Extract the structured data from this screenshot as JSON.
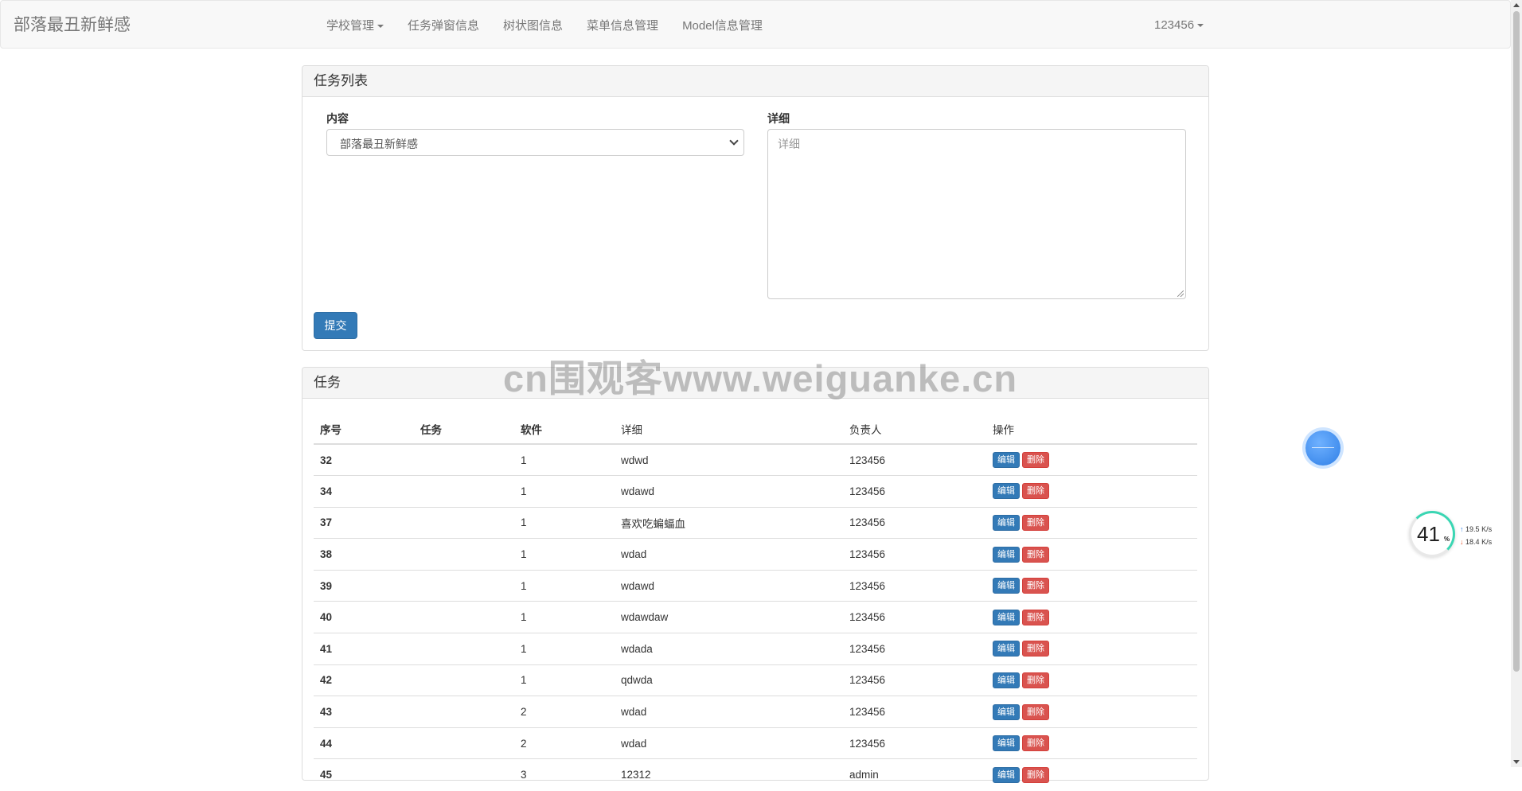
{
  "navbar": {
    "brand": "部落最丑新鲜感",
    "links": [
      "学校管理",
      "任务弹窗信息",
      "树状图信息",
      "菜单信息管理",
      "Model信息管理"
    ],
    "user": "123456"
  },
  "form_panel": {
    "title": "任务列表",
    "content_label": "内容",
    "content_selected": "部落最丑新鲜感",
    "detail_label": "详细",
    "detail_placeholder": "详细",
    "submit_label": "提交"
  },
  "table_panel": {
    "title": "任务",
    "headers": [
      "序号",
      "任务",
      "软件",
      "详细",
      "负责人",
      "操作"
    ],
    "edit_label": "编辑",
    "delete_label": "删除",
    "rows": [
      {
        "id": "32",
        "task": "",
        "software": "1",
        "detail": "wdwd",
        "owner": "123456"
      },
      {
        "id": "34",
        "task": "",
        "software": "1",
        "detail": "wdawd",
        "owner": "123456"
      },
      {
        "id": "37",
        "task": "",
        "software": "1",
        "detail": "喜欢吃蝙蝠血",
        "owner": "123456"
      },
      {
        "id": "38",
        "task": "",
        "software": "1",
        "detail": "wdad",
        "owner": "123456"
      },
      {
        "id": "39",
        "task": "",
        "software": "1",
        "detail": "wdawd",
        "owner": "123456"
      },
      {
        "id": "40",
        "task": "",
        "software": "1",
        "detail": "wdawdaw",
        "owner": "123456"
      },
      {
        "id": "41",
        "task": "",
        "software": "1",
        "detail": "wdada",
        "owner": "123456"
      },
      {
        "id": "42",
        "task": "",
        "software": "1",
        "detail": "qdwda",
        "owner": "123456"
      },
      {
        "id": "43",
        "task": "",
        "software": "2",
        "detail": "wdad",
        "owner": "123456"
      },
      {
        "id": "44",
        "task": "",
        "software": "2",
        "detail": "wdad",
        "owner": "123456"
      },
      {
        "id": "45",
        "task": "",
        "software": "3",
        "detail": "12312",
        "owner": "admin"
      }
    ]
  },
  "watermark": "cn围观客www.weiguanke.cn",
  "monitor": {
    "percent": "41",
    "percent_unit": "%",
    "upload": "19.5",
    "download": "18.4",
    "speed_unit": "K/s"
  },
  "colors": {
    "primary": "#337ab7",
    "danger": "#d9534f",
    "navbar_bg": "#f8f8f8",
    "panel_heading_bg": "#f5f5f5"
  }
}
